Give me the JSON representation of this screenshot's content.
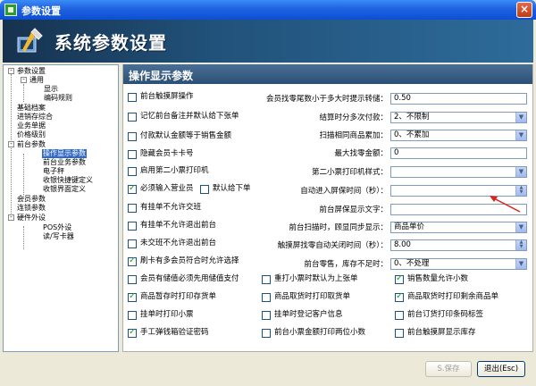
{
  "window": {
    "title": "参数设置",
    "banner_title": "系统参数设置"
  },
  "sidebar": {
    "items": [
      {
        "label": "参数设置"
      },
      {
        "label": "通用"
      },
      {
        "label": "显示"
      },
      {
        "label": "编码规则"
      },
      {
        "label": "基础档案"
      },
      {
        "label": "进销存综合"
      },
      {
        "label": "业务单据"
      },
      {
        "label": "价格级别"
      },
      {
        "label": "前台参数"
      },
      {
        "label": "操作显示参数"
      },
      {
        "label": "前台业务参数"
      },
      {
        "label": "电子秤"
      },
      {
        "label": "收银快捷键定义"
      },
      {
        "label": "收银界面定义"
      },
      {
        "label": "会员参数"
      },
      {
        "label": "连锁参数"
      },
      {
        "label": "硬件外设"
      },
      {
        "label": "POS外设"
      },
      {
        "label": "读/写卡器"
      }
    ]
  },
  "panel": {
    "header": "操作显示参数",
    "left_checks": [
      {
        "label": "前台触摸屏操作",
        "checked": false
      },
      {
        "label": "记忆前台备注并默认给下张单",
        "checked": false
      },
      {
        "label": "付款默认金额等于销售金额",
        "checked": false
      },
      {
        "label": "隐藏会员卡卡号",
        "checked": false
      },
      {
        "label": "启用第二小票打印机",
        "checked": false
      },
      {
        "label": "必须输入营业员",
        "checked": true
      },
      {
        "label": "默认给下单",
        "checked": false
      },
      {
        "label": "有挂单不允许交班",
        "checked": false
      },
      {
        "label": "有挂单不允许退出前台",
        "checked": false
      },
      {
        "label": "未交班不允许退出前台",
        "checked": false
      },
      {
        "label": "刷卡有多会员符合时允许选择",
        "checked": true
      }
    ],
    "right_fields": [
      {
        "label": "会员找零尾数小于多大时提示转储：",
        "value": "0.50",
        "type": "text"
      },
      {
        "label": "结算时分多次付款：",
        "value": "2、不限制",
        "type": "select"
      },
      {
        "label": "扫描相同商品累加：",
        "value": "0、不累加",
        "type": "select"
      },
      {
        "label": "最大找零金额：",
        "value": "0",
        "type": "text"
      },
      {
        "label": "第二小票打印机样式：",
        "value": "",
        "type": "select"
      },
      {
        "label": "自动进入屏保时间（秒）：",
        "value": "",
        "type": "spin"
      },
      {
        "label": "前台屏保显示文字：",
        "value": "",
        "type": "text"
      },
      {
        "label": "前台扫描时，顾显同步显示：",
        "value": "商品单价",
        "type": "select"
      },
      {
        "label": "触摸屏找零自动关闭时间（秒）：",
        "value": "8.00",
        "type": "spin"
      },
      {
        "label": "前台零售，库存不足时：",
        "value": "0、不处理",
        "type": "select"
      }
    ],
    "grid_checks": [
      {
        "label": "会员有储值必须先用储值支付",
        "checked": false
      },
      {
        "label": "重打小票时默认为上张单",
        "checked": false
      },
      {
        "label": "销售数量允许小数",
        "checked": true
      },
      {
        "label": "商品暂存时打印存货单",
        "checked": true
      },
      {
        "label": "商品取货时打印取货单",
        "checked": false
      },
      {
        "label": "商品取货时打印剩余商品单",
        "checked": true
      },
      {
        "label": "挂单时打印小票",
        "checked": false
      },
      {
        "label": "挂单时登记客户信息",
        "checked": false
      },
      {
        "label": "前台订货打印条码标签",
        "checked": false
      },
      {
        "label": "手工弹钱箱验证密码",
        "checked": true
      },
      {
        "label": "前台小票金额打印两位小数",
        "checked": false
      },
      {
        "label": "前台触摸屏显示库存",
        "checked": false
      }
    ]
  },
  "buttons": {
    "save": "S.保存",
    "exit": "退出(Esc)"
  }
}
